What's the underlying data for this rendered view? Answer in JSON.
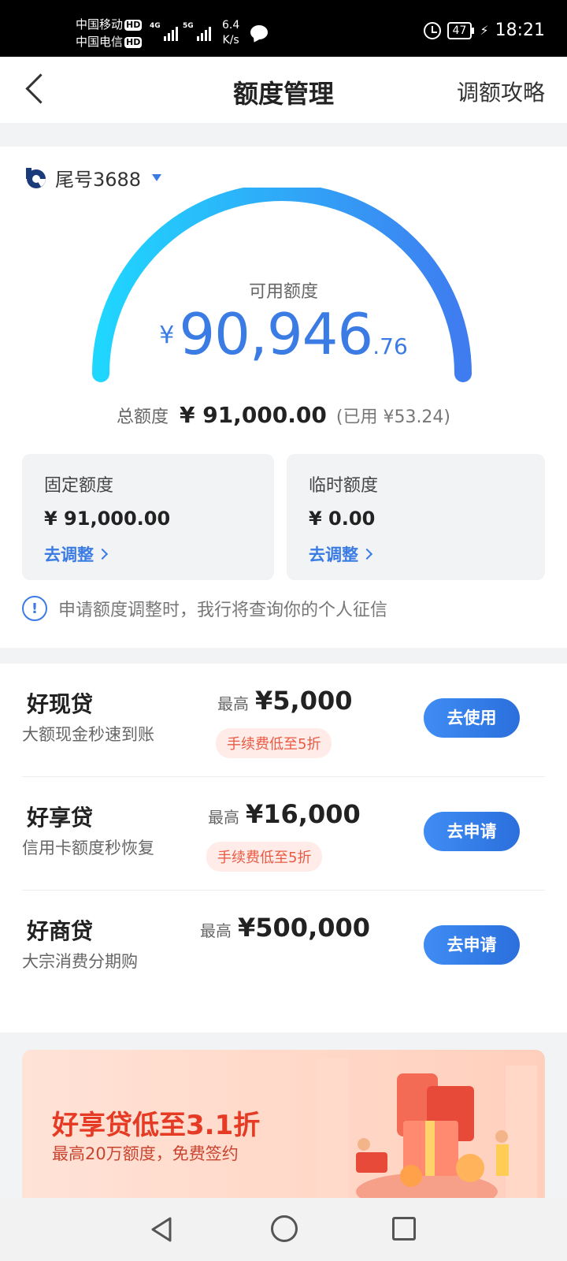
{
  "status_bar": {
    "carrier1": "中国移动",
    "carrier2": "中国电信",
    "hd": "HD",
    "net1": "4G",
    "net2": "5G",
    "speed_value": "6.4",
    "speed_unit": "K/s",
    "battery": "47",
    "time": "18:21"
  },
  "header": {
    "title": "额度管理",
    "guide_link": "调额攻略"
  },
  "account": {
    "label": "尾号3688"
  },
  "credit": {
    "available_label": "可用额度",
    "currency": "¥",
    "available_int": "90,946",
    "available_dec": ".76",
    "total_label": "总额度",
    "total_value": "¥ 91,000.00",
    "used_text": "(已用 ¥53.24)",
    "fixed": {
      "label": "固定额度",
      "value": "¥ 91,000.00",
      "action": "去调整"
    },
    "temp": {
      "label": "临时额度",
      "value": "¥ 0.00",
      "action": "去调整"
    },
    "notice": "申请额度调整时，我行将查询你的个人征信"
  },
  "colors": {
    "accent": "#3a7be4",
    "gauge_start": "#1fd6ff",
    "gauge_end": "#3f7cf0",
    "promo": "#e53a24"
  },
  "loans": [
    {
      "name": "好现贷",
      "desc": "大额现金秒速到账",
      "max_label": "最高",
      "max_value": "¥5,000",
      "fee": "手续费低至5折",
      "button": "去使用"
    },
    {
      "name": "好享贷",
      "desc": "信用卡额度秒恢复",
      "max_label": "最高",
      "max_value": "¥16,000",
      "fee": "手续费低至5折",
      "button": "去申请"
    },
    {
      "name": "好商贷",
      "desc": "大宗消费分期购",
      "max_label": "最高",
      "max_value": "¥500,000",
      "button": "去申请"
    }
  ],
  "banner": {
    "title": "好享贷低至3.1折",
    "subtitle": "最高20万额度，免费签约"
  },
  "icons": {
    "back": "chevron-left-icon",
    "bank": "bank-logo-icon",
    "info": "info-circle-icon",
    "nav": [
      "nav-back-icon",
      "nav-home-icon",
      "nav-recent-icon"
    ]
  }
}
